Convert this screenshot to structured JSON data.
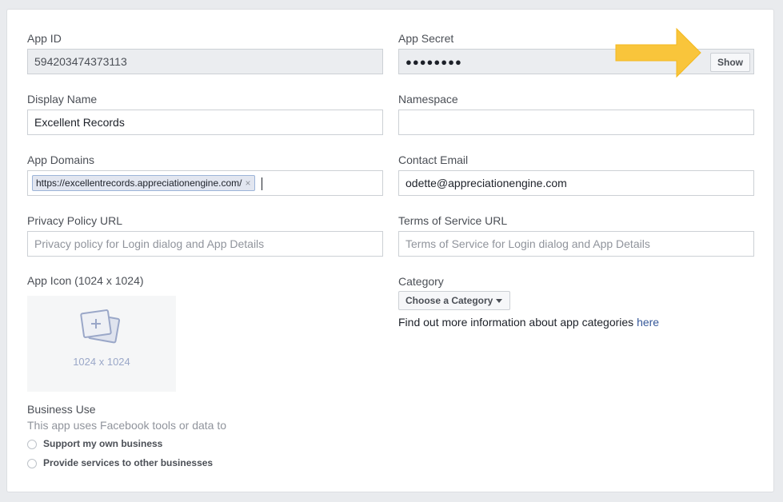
{
  "form": {
    "app_id": {
      "label": "App ID",
      "value": "594203474373113"
    },
    "app_secret": {
      "label": "App Secret",
      "value": "●●●●●●●●",
      "show_button": "Show"
    },
    "display_name": {
      "label": "Display Name",
      "value": "Excellent Records"
    },
    "namespace": {
      "label": "Namespace",
      "value": ""
    },
    "app_domains": {
      "label": "App Domains",
      "tag": "https://excellentrecords.appreciationengine.com/",
      "tag_remove": "×"
    },
    "contact_email": {
      "label": "Contact Email",
      "value": "odette@appreciationengine.com"
    },
    "privacy_policy": {
      "label": "Privacy Policy URL",
      "placeholder": "Privacy policy for Login dialog and App Details"
    },
    "terms_of_service": {
      "label": "Terms of Service URL",
      "placeholder": "Terms of Service for Login dialog and App Details"
    },
    "app_icon": {
      "label": "App Icon (1024 x 1024)",
      "caption": "1024 x 1024",
      "icon": "image-add-icon"
    },
    "category": {
      "label": "Category",
      "button": "Choose a Category",
      "info_text": "Find out more information about app categories ",
      "info_link": "here"
    },
    "business_use": {
      "label": "Business Use",
      "description": "This app uses Facebook tools or data to",
      "options": [
        "Support my own business",
        "Provide services to other businesses"
      ]
    }
  },
  "colors": {
    "arrow": "#f9c53b",
    "link": "#365899"
  }
}
